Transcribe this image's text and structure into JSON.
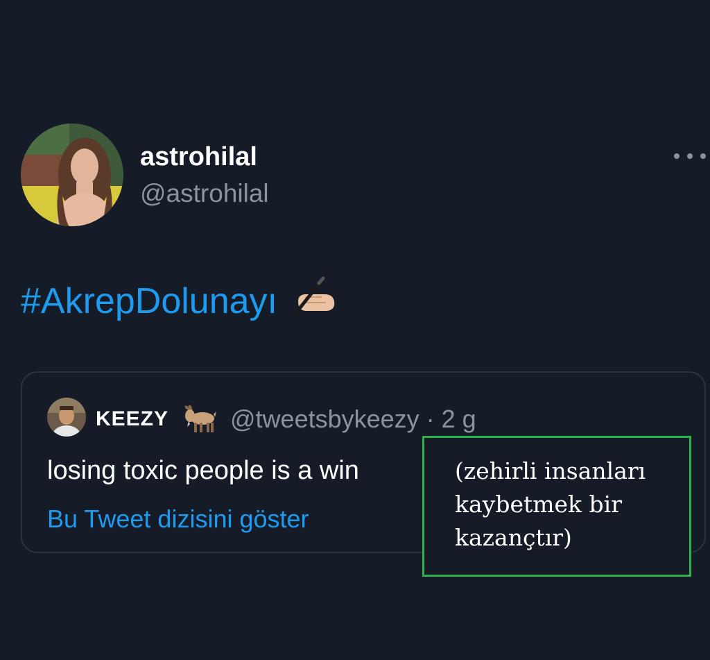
{
  "tweet": {
    "display_name": "astrohilal",
    "handle": "@astrohilal",
    "hashtag": "#AkrepDolunayı",
    "emoji_icon": "writing-hand-icon",
    "more_icon": "more-options-icon"
  },
  "quoted_tweet": {
    "display_name": "KEEZY",
    "name_emoji_icon": "goat-icon",
    "meta": "@tweetsbykeezy · 2 g",
    "text": "losing toxic people is a win",
    "show_thread_label": "Bu Tweet dizisini göster"
  },
  "translation_note": {
    "lines": [
      "(zehirli insanları",
      "kaybetmek bir",
      "kazançtır)"
    ],
    "border_color": "#2bb24c"
  },
  "colors": {
    "background": "#161c27",
    "accent": "#1d9bf0",
    "secondary_text": "#8a949e",
    "card_border": "#2b3340"
  }
}
